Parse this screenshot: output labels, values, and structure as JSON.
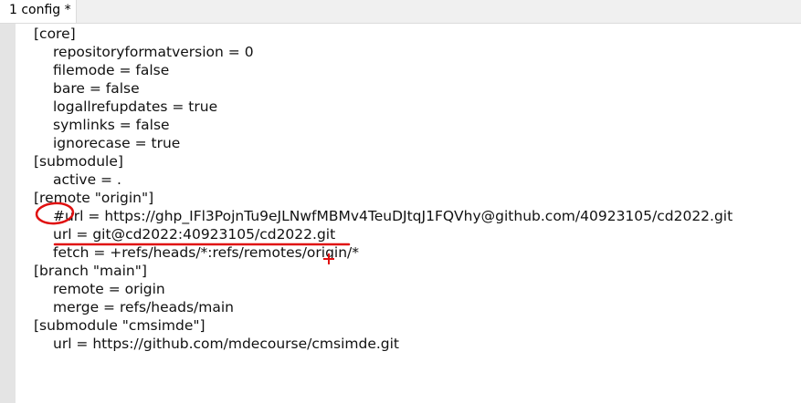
{
  "tab": {
    "label": "1 config *"
  },
  "editor": {
    "lines": [
      {
        "text": "[core]",
        "indent": false
      },
      {
        "text": "repositoryformatversion = 0",
        "indent": true
      },
      {
        "text": "filemode = false",
        "indent": true
      },
      {
        "text": "bare = false",
        "indent": true
      },
      {
        "text": "logallrefupdates = true",
        "indent": true
      },
      {
        "text": "symlinks = false",
        "indent": true
      },
      {
        "text": "ignorecase = true",
        "indent": true
      },
      {
        "text": "[submodule]",
        "indent": false
      },
      {
        "text": "active = .",
        "indent": true
      },
      {
        "text": "[remote \"origin\"]",
        "indent": false
      },
      {
        "text": "#url = https://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@github.com/40923105/cd2022.git",
        "indent": true
      },
      {
        "text": "url = git@cd2022:40923105/cd2022.git",
        "indent": true
      },
      {
        "text": "fetch = +refs/heads/*:refs/remotes/origin/*",
        "indent": true
      },
      {
        "text": "[branch \"main\"]",
        "indent": false
      },
      {
        "text": "remote = origin",
        "indent": true
      },
      {
        "text": "merge = refs/heads/main",
        "indent": true
      },
      {
        "text": "[submodule \"cmsimde\"]",
        "indent": false
      },
      {
        "text": "url = https://github.com/mdecourse/cmsimde.git",
        "indent": true
      }
    ]
  },
  "annotations": {
    "color": "#e01010"
  }
}
